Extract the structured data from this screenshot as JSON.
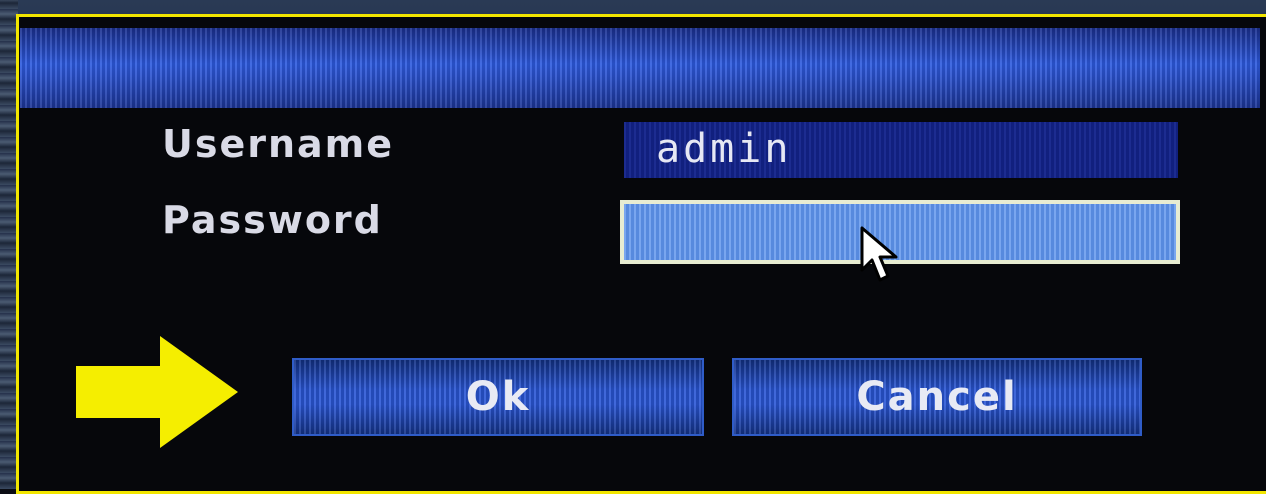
{
  "dialog": {
    "title": "",
    "username_label": "Username",
    "password_label": "Password",
    "username_value": "admin",
    "password_value": "",
    "ok_label": "Ok",
    "cancel_label": "Cancel"
  },
  "colors": {
    "frame_border": "#f2e600",
    "annotation_arrow": "#f5ee00",
    "title_bar": "#2e5be0",
    "username_field": "#13238c",
    "password_field_focused": "#5c93ec",
    "button": "#2b57d6",
    "label_text": "#d9dae6"
  },
  "icons": {
    "pointer": "mouse-pointer-icon",
    "annotation": "right-arrow-annotation-icon"
  }
}
